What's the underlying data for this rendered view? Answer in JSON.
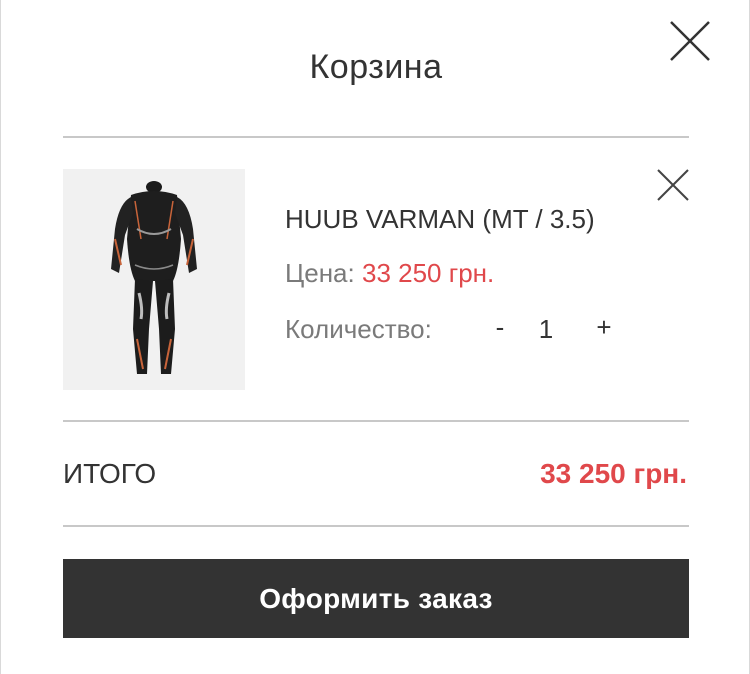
{
  "cart": {
    "title": "Корзина",
    "close_icon": "close-icon",
    "item": {
      "name": "HUUB VARMAN (MT / 3.5)",
      "price_label": "Цена:",
      "price_value": "33 250 грн.",
      "quantity_label": "Количество:",
      "quantity_minus": "-",
      "quantity_value": "1",
      "quantity_plus": "+",
      "remove_icon": "close-icon",
      "image": "wetsuit-product-photo"
    },
    "total_label": "ИТОГО",
    "total_value": "33 250 грн.",
    "checkout_label": "Оформить заказ"
  },
  "colors": {
    "accent": "#e0484b",
    "button_bg": "#333333",
    "divider": "#c8c8c8",
    "muted_text": "#7a7a7a"
  }
}
